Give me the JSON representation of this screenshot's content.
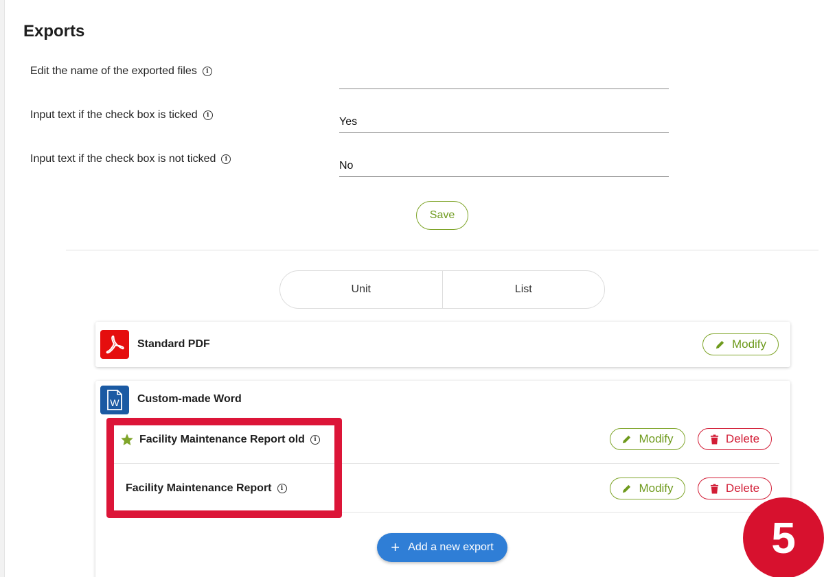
{
  "page": {
    "title": "Exports"
  },
  "settings": [
    {
      "label": "Edit the name of the exported files",
      "value": ""
    },
    {
      "label": "Input text if the check box is ticked",
      "value": "Yes"
    },
    {
      "label": "Input text if the check box is not ticked",
      "value": "No"
    }
  ],
  "save_label": "Save",
  "view_toggle": {
    "options": [
      "Unit",
      "List"
    ]
  },
  "exports": {
    "standard": {
      "title": "Standard PDF",
      "icon": "pdf-icon",
      "modify_label": "Modify"
    },
    "custom": {
      "title": "Custom-made Word",
      "icon": "word-icon",
      "templates": [
        {
          "name": "Facility Maintenance Report old",
          "is_default": true,
          "modify_label": "Modify",
          "delete_label": "Delete"
        },
        {
          "name": "Facility Maintenance Report",
          "is_default": false,
          "modify_label": "Modify",
          "delete_label": "Delete"
        }
      ]
    },
    "add_label": "Add a new export"
  },
  "step_badge": "5",
  "colors": {
    "green": "#6e9a1d",
    "red": "#d21d36",
    "blue": "#2f7ed6",
    "highlight": "#dc1538",
    "pdf_red": "#e50e0e",
    "word_blue": "#1b5aa3"
  }
}
